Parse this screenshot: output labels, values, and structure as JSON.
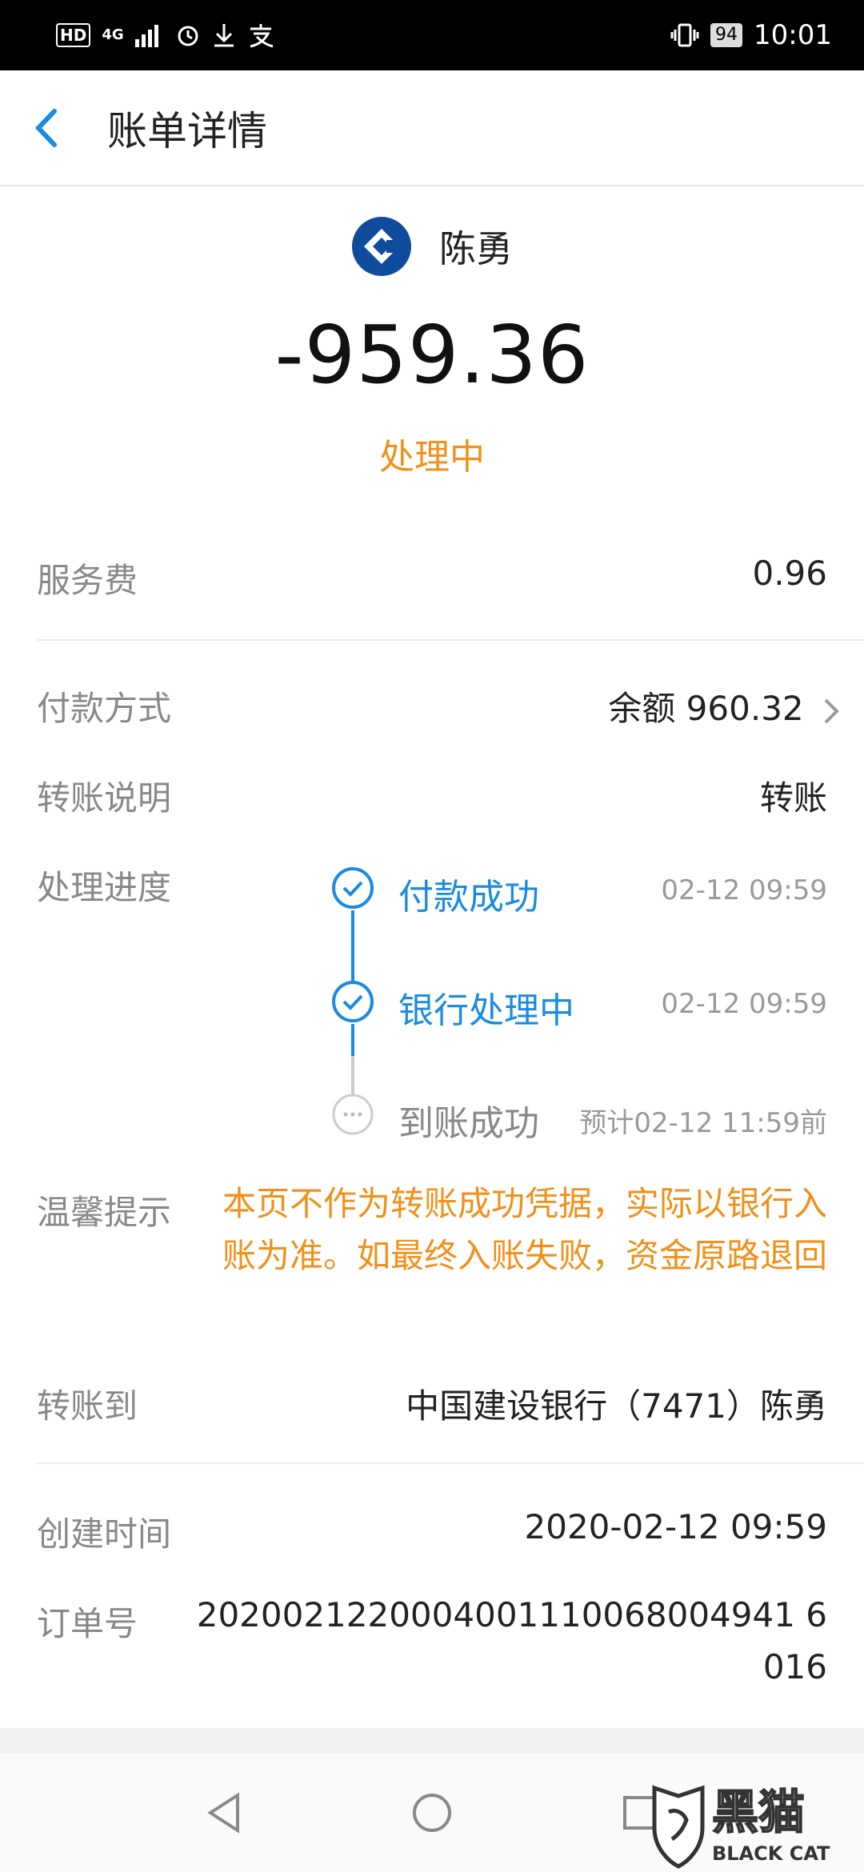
{
  "statusbar": {
    "left_hd": "HD",
    "left_net": "4G",
    "right_battery": "94",
    "time": "10:01"
  },
  "header": {
    "title": "账单详情"
  },
  "payee": {
    "name": "陈勇",
    "icon": "ccb-bank-logo-icon"
  },
  "amount": "-959.36",
  "status": "处理中",
  "rows": {
    "fee_label": "服务费",
    "fee_value": "0.96",
    "payment_label": "付款方式",
    "payment_value": "余额 960.32",
    "note_label": "转账说明",
    "note_value": "转账",
    "progress_label": "处理进度",
    "tip_label": "温馨提示",
    "tip_text": "本页不作为转账成功凭据，实际以银行入账为准。如最终入账失败，资金原路退回",
    "to_label": "转账到",
    "to_value": "中国建设银行（7471）陈勇",
    "created_label": "创建时间",
    "created_value": "2020-02-12 09:59",
    "order_label": "订单号",
    "order_value": "2020021220004001110068004941 6016"
  },
  "progress": [
    {
      "label": "付款成功",
      "time": "02-12 09:59",
      "state": "done"
    },
    {
      "label": "银行处理中",
      "time": "02-12 09:59",
      "state": "done"
    },
    {
      "label": "到账成功",
      "time": "预计02-12 11:59前",
      "state": "pending"
    }
  ],
  "watermark": {
    "text_cn": "黑猫",
    "text_en": "BLACK CAT"
  },
  "colors": {
    "accent": "#1a8be0",
    "warning": "#f0901a",
    "pending": "#cccccc"
  }
}
